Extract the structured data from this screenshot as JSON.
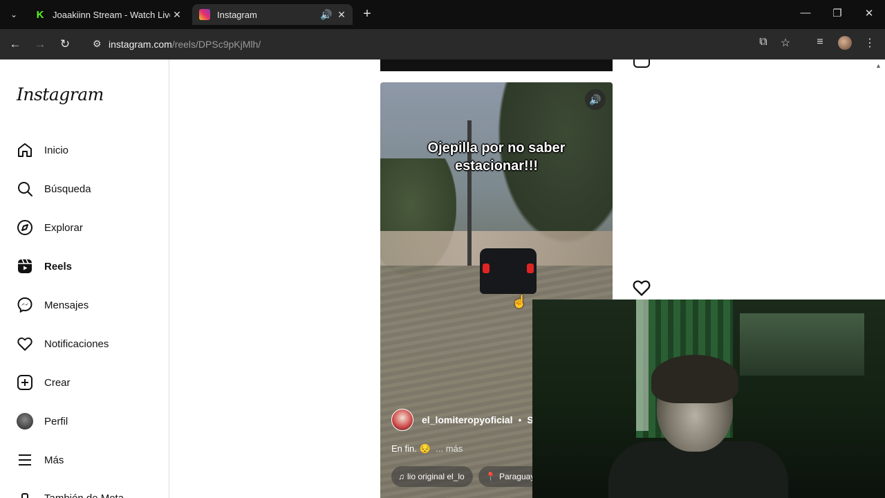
{
  "browser": {
    "tabs": [
      {
        "title": "Joaakiinn Stream - Watch Live c",
        "favicon": "K"
      },
      {
        "title": "Instagram"
      }
    ],
    "url_host": "instagram.com",
    "url_path": "/reels/DPSc9pKjMlh/"
  },
  "sidebar": {
    "logo": "Instagram",
    "items": [
      {
        "label": "Inicio",
        "icon": "home-icon"
      },
      {
        "label": "Búsqueda",
        "icon": "search-icon"
      },
      {
        "label": "Explorar",
        "icon": "compass-icon"
      },
      {
        "label": "Reels",
        "icon": "reels-icon"
      },
      {
        "label": "Mensajes",
        "icon": "messenger-icon"
      },
      {
        "label": "Notificaciones",
        "icon": "heart-icon"
      },
      {
        "label": "Crear",
        "icon": "plus-square-icon"
      },
      {
        "label": "Perfil",
        "icon": "avatar"
      },
      {
        "label": "Más",
        "icon": "menu-icon"
      },
      {
        "label": "También de Meta",
        "icon": "meta-icon"
      }
    ]
  },
  "reel": {
    "overlay_text_line1": "Ojepilla por no saber",
    "overlay_text_line2": "estacionar!!!",
    "username": "el_lomiteropyoficial",
    "follow": "Se",
    "description": "En fin. 😔",
    "more": "... más",
    "audio": "lio original  el_lo",
    "location": "Paraguay"
  },
  "colors": {
    "tabbar": "#0f0f10",
    "toolbar": "#2a2a2b",
    "kick_green": "#53fc18",
    "border": "#dbdbdb"
  }
}
